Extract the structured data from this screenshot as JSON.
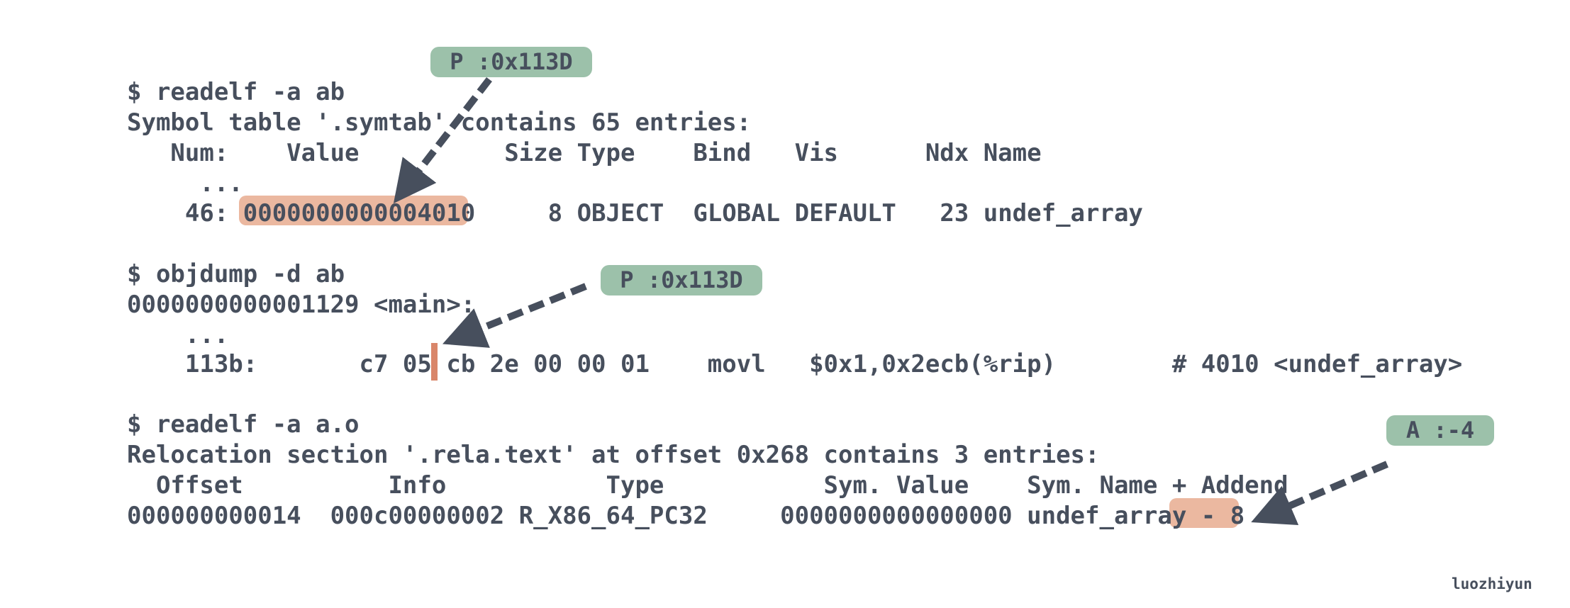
{
  "colors": {
    "text": "#474f5d",
    "highlight": "#ebb8a0",
    "badge": "#9cc1aa",
    "cursor": "#d9866a",
    "arrow": "#474f5d"
  },
  "block1": {
    "cmd": "$ readelf -a ab",
    "title": "Symbol table '.symtab' contains 65 entries:",
    "header": "   Num:    Value          Size Type    Bind   Vis      Ndx Name",
    "dots": "     ...",
    "row_prefix": "    46: ",
    "row_value": "0000000000004010",
    "row_suffix": "     8 OBJECT  GLOBAL DEFAULT   23 undef_array"
  },
  "block2": {
    "cmd": "$ objdump -d ab",
    "func": "0000000000001129 <main>:",
    "dots": "    ...",
    "row_prefix": "    113b:       c7 05 ",
    "row_suffix": "cb 2e 00 00 01    movl   $0x1,0x2ecb(%rip)        # 4010 <undef_array>"
  },
  "block3": {
    "cmd": "$ readelf -a a.o",
    "title": "Relocation section '.rela.text' at offset 0x268 contains 3 entries:",
    "header": "  Offset          Info           Type           Sym. Value    Sym. Name + Addend",
    "row_prefix": "000000000014  000c00000002 R_X86_64_PC32     0000000000000000 undef_array ",
    "row_addend": "- 8"
  },
  "badges": {
    "p1": "P :0x113D",
    "p2": "P :0x113D",
    "a": "A :-4"
  },
  "watermark": "luozhiyun"
}
